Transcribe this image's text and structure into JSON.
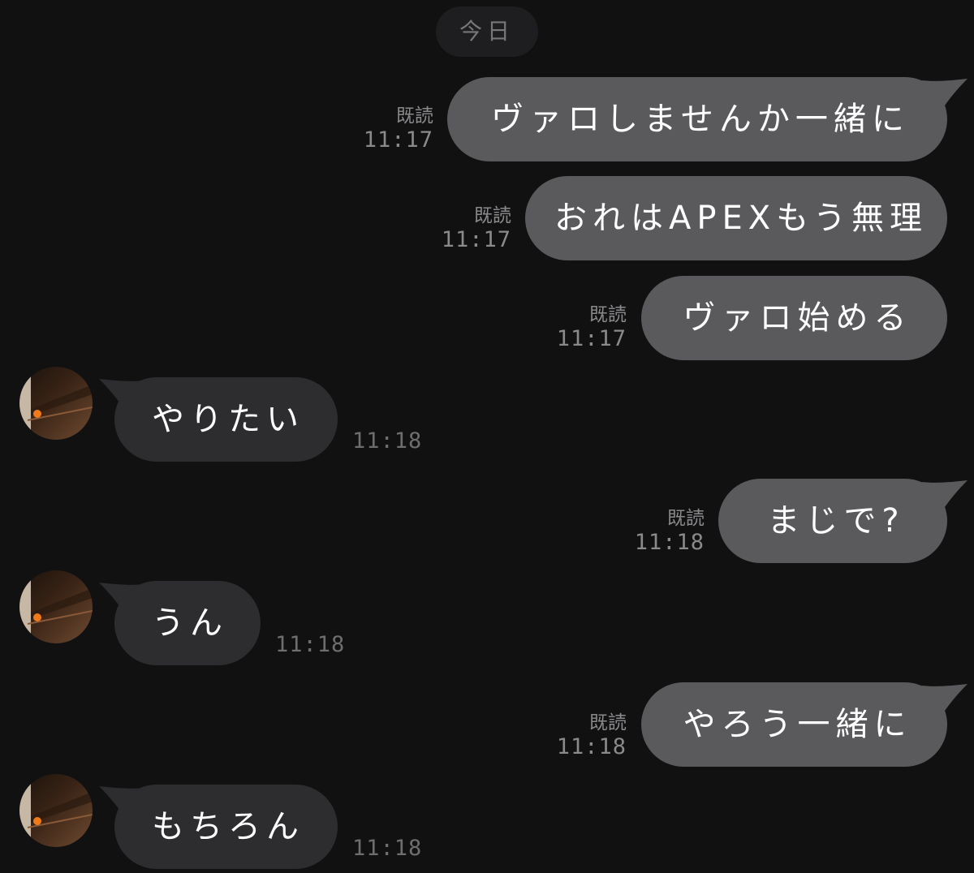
{
  "date_divider": "今日",
  "messages": [
    {
      "side": "sent",
      "text": "ヴァロしませんか一緒に",
      "read": "既読",
      "time": "11:17"
    },
    {
      "side": "sent",
      "text": "おれはAPEXもう無理",
      "read": "既読",
      "time": "11:17"
    },
    {
      "side": "sent",
      "text": "ヴァロ始める",
      "read": "既読",
      "time": "11:17"
    },
    {
      "side": "recv",
      "text": "やりたい",
      "time": "11:18"
    },
    {
      "side": "sent",
      "text": "まじで?",
      "read": "既読",
      "time": "11:18"
    },
    {
      "side": "recv",
      "text": "うん",
      "time": "11:18"
    },
    {
      "side": "sent",
      "text": "やろう一緒に",
      "read": "既読",
      "time": "11:18"
    },
    {
      "side": "recv",
      "text": "もちろん",
      "time": "11:18"
    }
  ],
  "colors": {
    "background": "#111112",
    "sent_bubble": "#5a5a5d",
    "received_bubble": "#2d2d30",
    "meta_text": "#8a8a8d"
  }
}
